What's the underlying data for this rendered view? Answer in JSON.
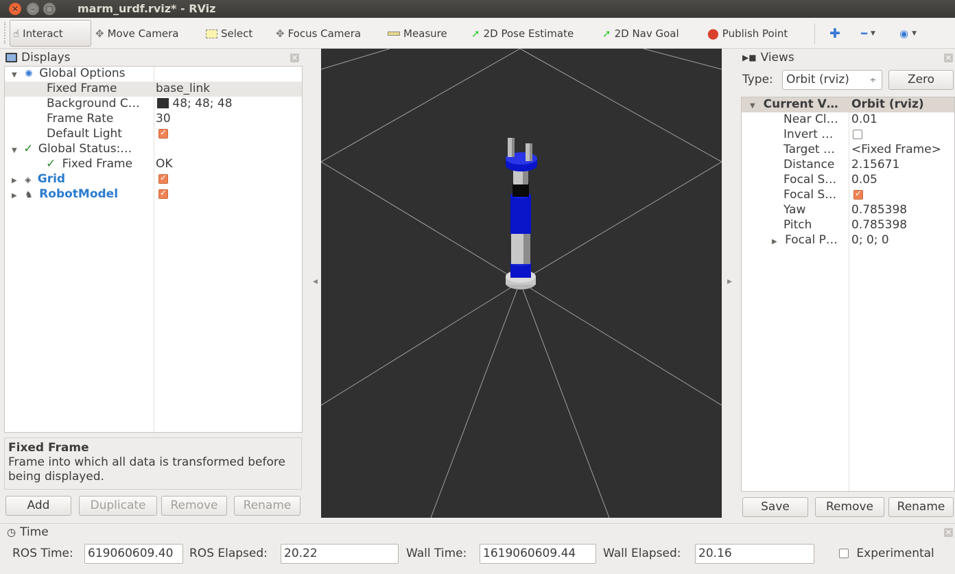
{
  "window": {
    "title": "marm_urdf.rviz* - RViz"
  },
  "toolbar": {
    "interact": "Interact",
    "move_camera": "Move Camera",
    "select": "Select",
    "focus_camera": "Focus Camera",
    "measure": "Measure",
    "pose_estimate": "2D Pose Estimate",
    "nav_goal": "2D Nav Goal",
    "publish_point": "Publish Point",
    "pose_color": "#2ecc2e",
    "publish_color": "#d9412b"
  },
  "displays": {
    "title": "Displays",
    "rows": {
      "global_options": "Global Options",
      "fixed_frame_key": "Fixed Frame",
      "fixed_frame_val": "base_link",
      "background_key": "Background C…",
      "background_val": "48; 48; 48",
      "frame_rate_key": "Frame Rate",
      "frame_rate_val": "30",
      "default_light_key": "Default Light",
      "global_status_key": "Global Status:…",
      "status_fixed_frame_key": "Fixed Frame",
      "status_fixed_frame_val": "OK",
      "grid_key": "Grid",
      "robot_model_key": "RobotModel"
    },
    "description_title": "Fixed Frame",
    "description_text": "Frame into which all data is transformed before being displayed.",
    "buttons": {
      "add": "Add",
      "duplicate": "Duplicate",
      "remove": "Remove",
      "rename": "Rename"
    }
  },
  "views": {
    "title": "Views",
    "type_label": "Type:",
    "type_value": "Orbit (rviz)",
    "zero": "Zero",
    "rows": {
      "current_key": "Current V…",
      "current_val": "Orbit (rviz)",
      "near_key": "Near Cl…",
      "near_val": "0.01",
      "invert_key": "Invert …",
      "target_key": "Target …",
      "target_val": "<Fixed Frame>",
      "distance_key": "Distance",
      "distance_val": "2.15671",
      "focal_s1_key": "Focal S…",
      "focal_s1_val": "0.05",
      "focal_s2_key": "Focal S…",
      "yaw_key": "Yaw",
      "yaw_val": "0.785398",
      "pitch_key": "Pitch",
      "pitch_val": "0.785398",
      "focal_p_key": "Focal P…",
      "focal_p_val": "0; 0; 0"
    },
    "buttons": {
      "save": "Save",
      "remove": "Remove",
      "rename": "Rename"
    }
  },
  "time": {
    "title": "Time",
    "ros_time_label": "ROS Time:",
    "ros_time": "619060609.40",
    "ros_elapsed_label": "ROS Elapsed:",
    "ros_elapsed": "20.22",
    "wall_time_label": "Wall Time:",
    "wall_time": "1619060609.44",
    "wall_elapsed_label": "Wall Elapsed:",
    "wall_elapsed": "20.16",
    "experimental": "Experimental"
  },
  "viewport": {
    "background": "#303030",
    "grid_color": "#a0a0a0",
    "link_blue": "#0a14c8",
    "link_grey": "#c8c8c8"
  }
}
